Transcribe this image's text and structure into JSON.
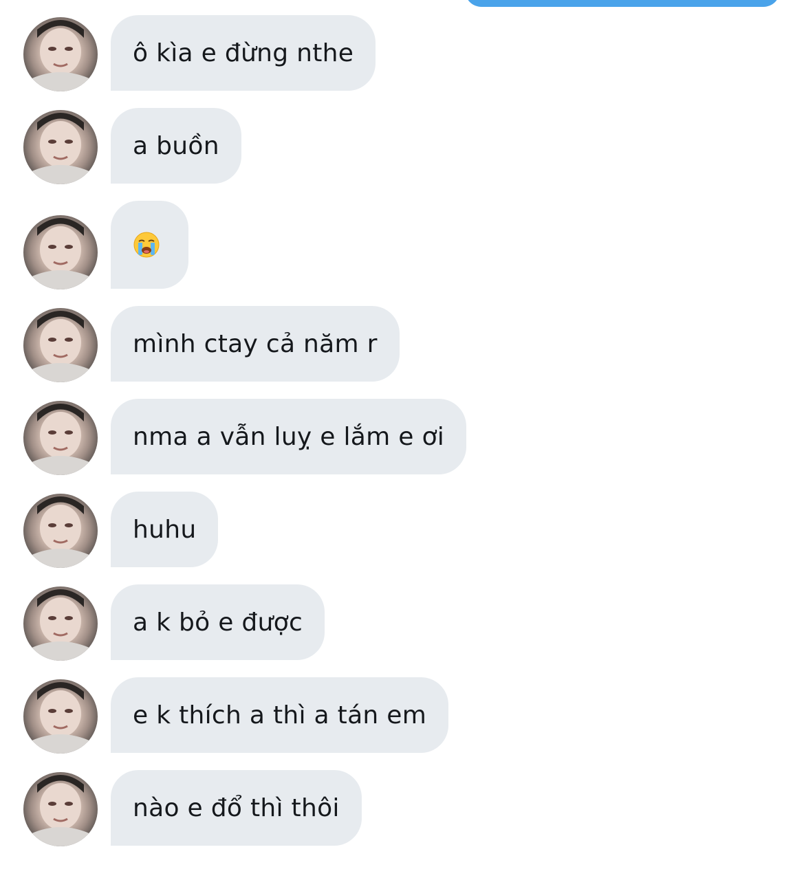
{
  "conversation": {
    "messages": [
      {
        "text": "ô kìa e đừng nthe",
        "type": "text"
      },
      {
        "text": "a buồn",
        "type": "text"
      },
      {
        "text": "😭",
        "type": "emoji",
        "icon": "loudly-crying-face-emoji"
      },
      {
        "text": "mình ctay cả năm r",
        "type": "text"
      },
      {
        "text": "nma a vẫn luỵ e lắm e ơi",
        "type": "text"
      },
      {
        "text": "huhu",
        "type": "text"
      },
      {
        "text": "a k bỏ e được",
        "type": "text"
      },
      {
        "text": "e k thích a thì a tán em",
        "type": "text"
      },
      {
        "text": "nào e đổ thì thôi",
        "type": "text"
      }
    ]
  },
  "colors": {
    "received_bubble": "#e7ebef",
    "sent_bubble": "#4aa3ea",
    "text": "#15181c",
    "background": "#ffffff"
  }
}
